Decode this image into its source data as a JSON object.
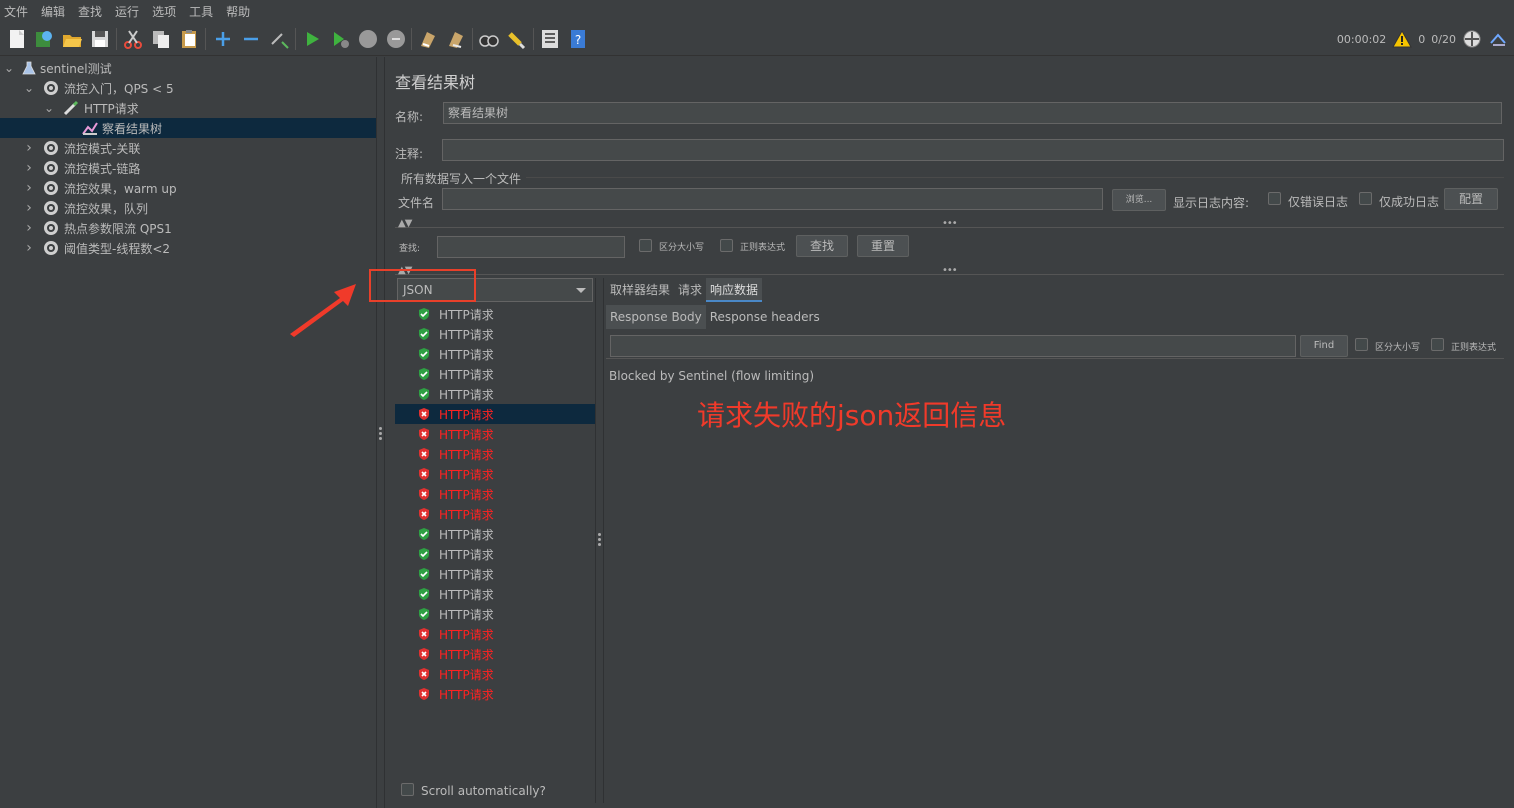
{
  "menu": [
    "文件",
    "编辑",
    "查找",
    "运行",
    "选项",
    "工具",
    "帮助"
  ],
  "status": {
    "elapsed": "00:00:02",
    "warnings": "0",
    "threads": "0/20"
  },
  "tree": [
    {
      "label": "sentinel测试",
      "level": 0,
      "expanded": true,
      "icon": "flask-icon"
    },
    {
      "label": "流控入门，QPS < 5",
      "level": 1,
      "expanded": true,
      "icon": "gear-icon"
    },
    {
      "label": "HTTP请求",
      "level": 2,
      "expanded": true,
      "icon": "pipette-icon"
    },
    {
      "label": "察看结果树",
      "level": 3,
      "icon": "chart-icon",
      "selected": true
    },
    {
      "label": "流控模式-关联",
      "level": 1,
      "icon": "gear-icon"
    },
    {
      "label": "流控模式-链路",
      "level": 1,
      "icon": "gear-icon"
    },
    {
      "label": "流控效果，warm up",
      "level": 1,
      "icon": "gear-icon"
    },
    {
      "label": "流控效果，队列",
      "level": 1,
      "icon": "gear-icon"
    },
    {
      "label": "热点参数限流 QPS1",
      "level": 1,
      "icon": "gear-icon"
    },
    {
      "label": "阈值类型-线程数<2",
      "level": 1,
      "icon": "gear-icon"
    }
  ],
  "panel": {
    "title": "查看结果树",
    "name_label": "名称:",
    "name_value": "察看结果树",
    "comment_label": "注释:",
    "comment_value": "",
    "file_group_label": "所有数据写入一个文件",
    "file_label": "文件名",
    "file_value": "",
    "browse_label": "浏览...",
    "log_label": "显示日志内容:",
    "errors_only_label": "仅错误日志",
    "success_only_label": "仅成功日志",
    "config_label": "配置",
    "search_label": "查找:",
    "search_value": "",
    "case_label": "区分大小写",
    "regex_label": "正则表达式",
    "find_button": "查找",
    "reset_button": "重置",
    "renderer": "JSON",
    "scroll_label": "Scroll automatically?"
  },
  "results": [
    {
      "label": "HTTP请求",
      "ok": true
    },
    {
      "label": "HTTP请求",
      "ok": true
    },
    {
      "label": "HTTP请求",
      "ok": true
    },
    {
      "label": "HTTP请求",
      "ok": true
    },
    {
      "label": "HTTP请求",
      "ok": true
    },
    {
      "label": "HTTP请求",
      "ok": false,
      "selected": true
    },
    {
      "label": "HTTP请求",
      "ok": false
    },
    {
      "label": "HTTP请求",
      "ok": false
    },
    {
      "label": "HTTP请求",
      "ok": false
    },
    {
      "label": "HTTP请求",
      "ok": false
    },
    {
      "label": "HTTP请求",
      "ok": false
    },
    {
      "label": "HTTP请求",
      "ok": true
    },
    {
      "label": "HTTP请求",
      "ok": true
    },
    {
      "label": "HTTP请求",
      "ok": true
    },
    {
      "label": "HTTP请求",
      "ok": true
    },
    {
      "label": "HTTP请求",
      "ok": true
    },
    {
      "label": "HTTP请求",
      "ok": false
    },
    {
      "label": "HTTP请求",
      "ok": false
    },
    {
      "label": "HTTP请求",
      "ok": false
    },
    {
      "label": "HTTP请求",
      "ok": false
    }
  ],
  "detail": {
    "tabs": [
      "取样器结果",
      "请求",
      "响应数据"
    ],
    "active_tab": 2,
    "subtabs": [
      "Response Body",
      "Response headers"
    ],
    "find_button": "Find",
    "case_label": "区分大小写",
    "regex_label": "正则表达式",
    "body": "Blocked by Sentinel (flow limiting)"
  },
  "annotation": "请求失败的json返回信息",
  "colors": {
    "bg": "#3c3f41",
    "selection": "#0d293e",
    "fail": "#ff2222",
    "annotation": "#f03a2a"
  }
}
